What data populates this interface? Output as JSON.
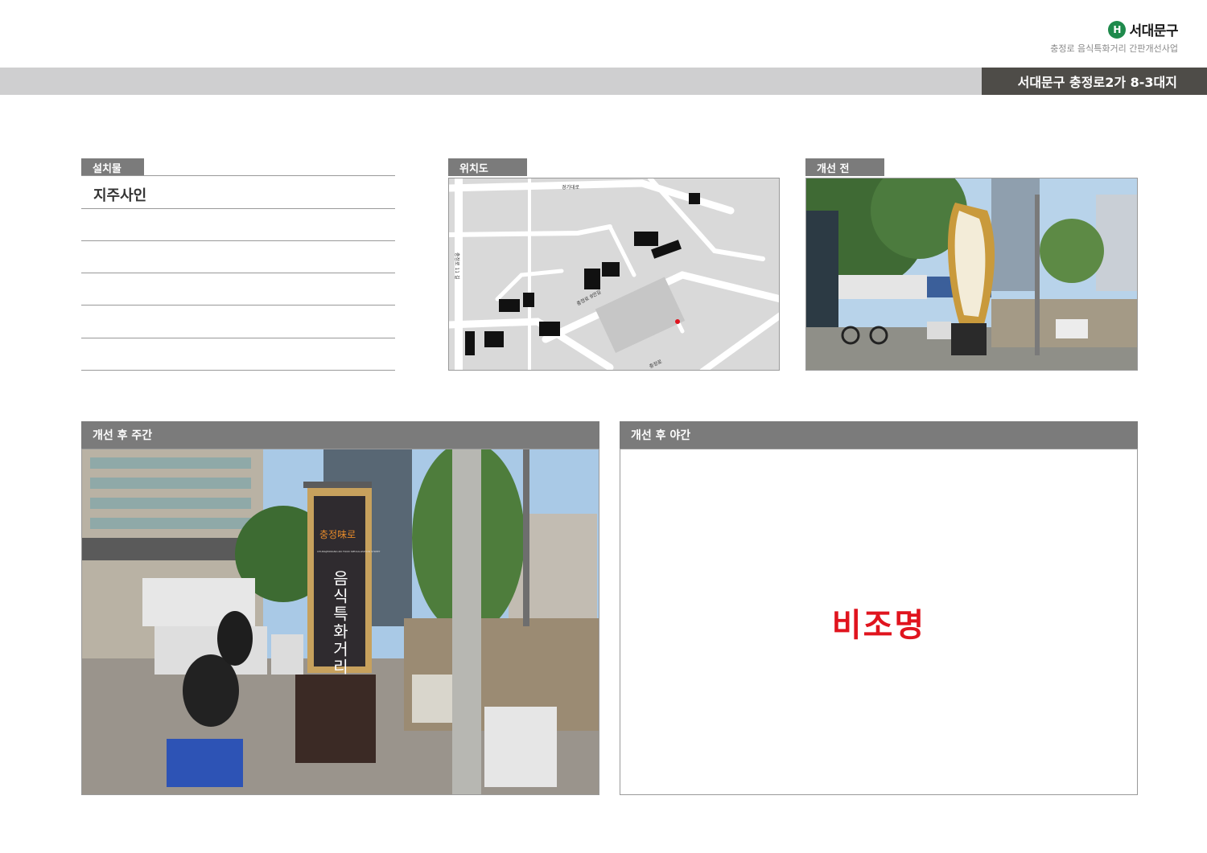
{
  "header": {
    "logo_mark": "H",
    "logo_text": "서대문구",
    "subtitle": "충정로 음식특화거리 간판개선사업",
    "location": "서대문구 충정로2가 8-3대지"
  },
  "install": {
    "label": "설치물",
    "value": "지주사인"
  },
  "map": {
    "label": "위치도",
    "roads": [
      "경기대로",
      "충정로 11 길",
      "충정로 9안길",
      "충정로"
    ]
  },
  "before": {
    "label": "개선 전"
  },
  "after_day": {
    "label": "개선 후 주간",
    "sign_top": "충정味로",
    "sign_main": "음식특화거리",
    "sign_small": "CHUNGJEONGNO-RO FOOD SPECIALIZATION STREET"
  },
  "after_night": {
    "label": "개선 후 야간",
    "message": "비조명"
  },
  "colors": {
    "header_bar": "#cfcfd0",
    "location_bg": "#4e4c48",
    "tab_bg": "#7b7b7b",
    "night_text": "#e0141e",
    "logo_green": "#1f8a4c"
  }
}
